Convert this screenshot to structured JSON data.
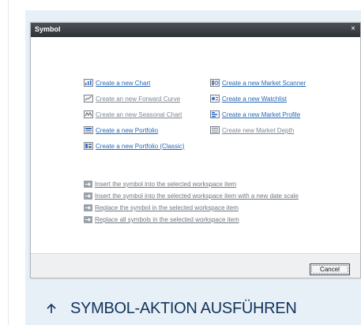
{
  "dialog": {
    "title": "Symbol",
    "close_glyph": "×",
    "create_links_left": [
      {
        "label": "Create a new Chart",
        "icon": "chart-icon",
        "enabled": true
      },
      {
        "label": "Create an new Forward Curve",
        "icon": "forward-curve-icon",
        "enabled": false
      },
      {
        "label": "Create an new Seasonal Chart",
        "icon": "seasonal-chart-icon",
        "enabled": false
      },
      {
        "label": "Create a new Portfolio",
        "icon": "portfolio-icon",
        "enabled": true
      },
      {
        "label": "Create a new Portfolio (Classic)",
        "icon": "portfolio-classic-icon",
        "enabled": true
      }
    ],
    "create_links_right": [
      {
        "label": "Create a new Market Scanner",
        "icon": "market-scanner-icon",
        "enabled": true
      },
      {
        "label": "Create a new Watchlist",
        "icon": "watchlist-icon",
        "enabled": true
      },
      {
        "label": "Create a new Market Profile",
        "icon": "market-profile-icon",
        "enabled": true
      },
      {
        "label": "Create new Market Depth",
        "icon": "market-depth-icon",
        "enabled": false
      }
    ],
    "workspace_actions": [
      {
        "label": "Insert the symbol into the selected workspace item",
        "icon": "insert-arrow-icon"
      },
      {
        "label": "Insert the symbol into the selected workspace item with a new date scale",
        "icon": "insert-arrow-icon"
      },
      {
        "label": "Replace the symbol in the selected workspace item",
        "icon": "replace-arrow-icon"
      },
      {
        "label": "Replace all symbols in the selected workspace item",
        "icon": "replace-arrow-icon"
      }
    ],
    "cancel_label": "Cancel"
  },
  "section_heading": {
    "icon": "arrow-up-icon",
    "label": "SYMBOL-AKTION AUSFÜHREN"
  },
  "colors": {
    "panel_bg": "#e7f0f6",
    "link": "#2866b4",
    "disabled": "#7f8790",
    "heading": "#12325c"
  }
}
